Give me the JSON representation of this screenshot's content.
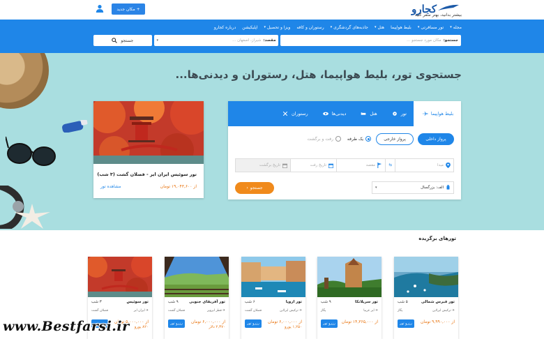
{
  "header": {
    "logo_text": "کجارو",
    "tagline": "بیشتر بدانید، بهتر سفر کنید",
    "add_place_label": "+ مکان جدید",
    "brand_color": "#1f86e8"
  },
  "nav": {
    "items": [
      {
        "label": "مجله",
        "dropdown": true
      },
      {
        "label": "تور مسافرتی",
        "dropdown": true
      },
      {
        "label": "بلیط هواپیما",
        "dropdown": false
      },
      {
        "label": "هتل",
        "dropdown": true
      },
      {
        "label": "جاذبه‌های گردشگری",
        "dropdown": true
      },
      {
        "label": "رستوران و کافه",
        "dropdown": false
      },
      {
        "label": "ویزا و تحصیل",
        "dropdown": true
      },
      {
        "label": "اپلیکیشن",
        "dropdown": false
      },
      {
        "label": "درباره کجارو",
        "dropdown": false
      }
    ]
  },
  "search": {
    "origin_label": "جستجو:",
    "origin_placeholder": "مکان مورد جستجو ...",
    "dest_label": "مقصد:",
    "dest_placeholder": "شیراز، اصفهان ...",
    "button_label": "جستجو"
  },
  "hero": {
    "title": "جستجوی تور، بلیط هواپیما، هتل، رستوران و دیدنی‌ها..."
  },
  "hero_tour": {
    "title": "تور سوئیس ایران ایر - فصلان گشت (۳ شب)",
    "price": "از ۱۹,۰۴۳,۶۰۰ تومان",
    "view_label": "مشاهده تور"
  },
  "panel": {
    "tabs": [
      {
        "label": "بلیط هواپیما",
        "icon": "plane-icon",
        "active": true
      },
      {
        "label": "تور",
        "icon": "compass-icon",
        "active": false
      },
      {
        "label": "هتل",
        "icon": "bed-icon",
        "active": false
      },
      {
        "label": "دیدنی‌ها",
        "icon": "eye-icon",
        "active": false
      },
      {
        "label": "رستوران",
        "icon": "cutlery-icon",
        "active": false
      }
    ],
    "domestic_label": "پرواز داخلی",
    "foreign_label": "پرواز خارجی",
    "oneway_label": "یک طرفه",
    "roundtrip_label": "رفت و برگشت",
    "origin_placeholder": "مبدا",
    "dest_placeholder": "مقصد",
    "depart_placeholder": "تاریخ رفت",
    "return_placeholder": "تاریخ برگشت",
    "passengers_value": "الف: بزرگسال",
    "search_label": "جستجو",
    "search_btn_color": "#f08a1c"
  },
  "featured": {
    "title": "تورهای برگزیده",
    "tours": [
      {
        "name": "تور قبرس شمالی",
        "nights": "۵ شب",
        "airline": "پگاز",
        "hotel": "ترکیش ایرلاین",
        "price": "از ۹,۹۹۰,۰۰۰ تومان",
        "button": "رزرو تور"
      },
      {
        "name": "تور سریلانکا",
        "nights": "۹ شب",
        "airline": "پگاز",
        "hotel": "ایر عربیا",
        "price": "از ۱۴,۳۶۵,۰۰۰ تومان",
        "button": "رزرو تور"
      },
      {
        "name": "تور اروپا",
        "nights": "۶ شب",
        "airline": "فصلان گشت",
        "hotel": "ترکیش ایرلاین",
        "price": "از ۶,۰۰۰,۰۰۰ تومان",
        "price2": "۱,۲۵۰ یورو",
        "button": "رزرو تور"
      },
      {
        "name": "تور آفریقای جنوبی",
        "nights": "۹ شب",
        "airline": "فصلان گشت",
        "hotel": "قطر ایرویز",
        "price": "از ۶,۰۰۰,۰۰۰ تومان",
        "price2": "۲,۳۷۰ دلار",
        "button": "رزرو تور"
      },
      {
        "name": "تور سوئیس",
        "nights": "۳ شب",
        "airline": "فصلان گشت",
        "hotel": "ایران ایر",
        "price": "از ۵,۰۰۰,۰۰۰ تومان",
        "price2": "۸۲۰ یورو",
        "button": "رزرو تور"
      }
    ]
  },
  "watermark": "www.Bestfarsi.ir"
}
